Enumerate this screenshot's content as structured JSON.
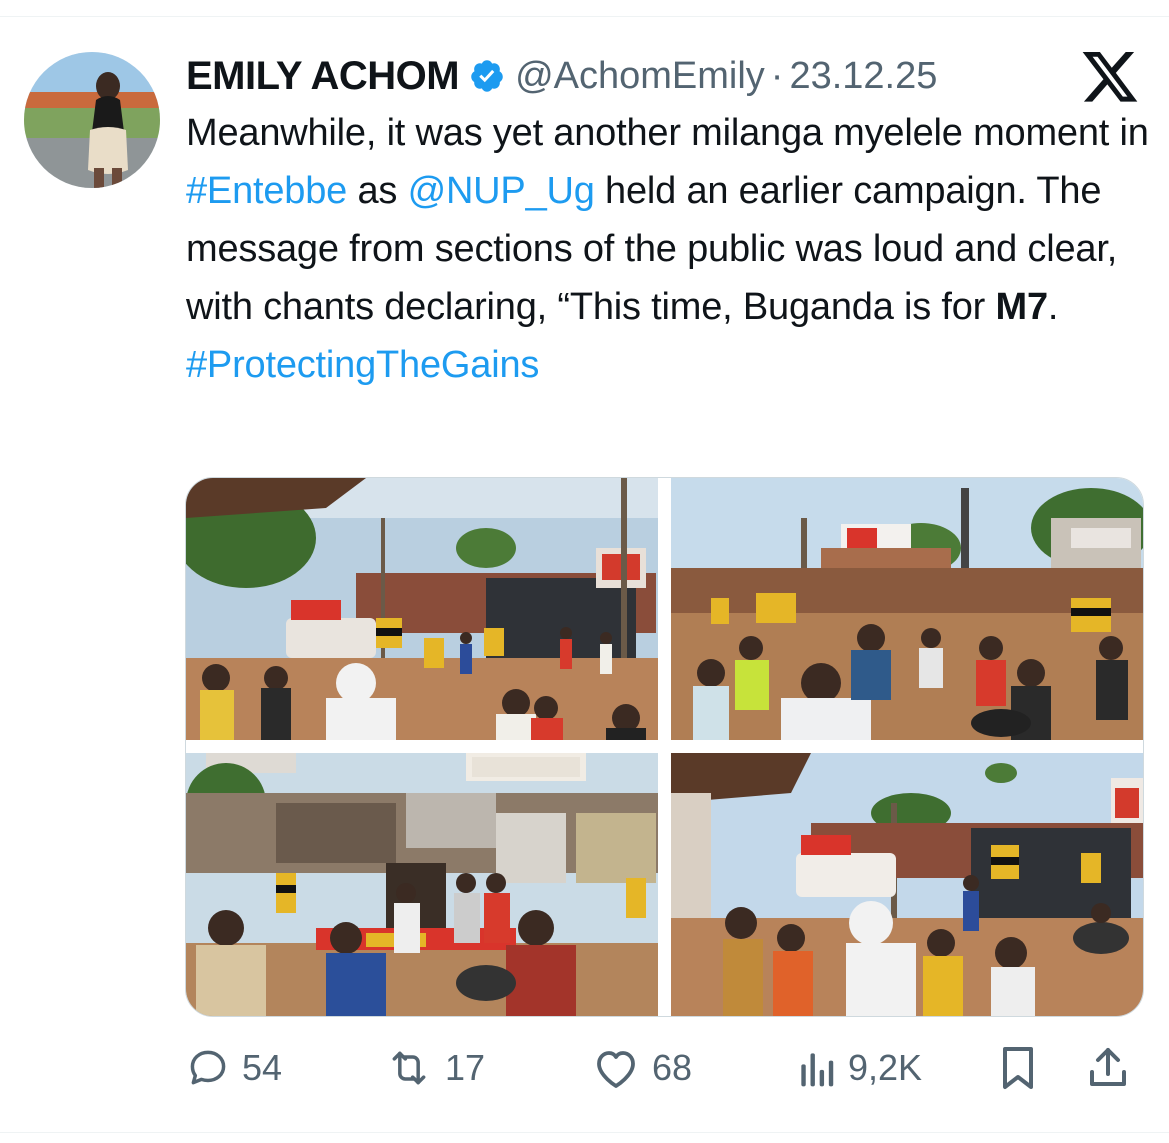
{
  "tweet": {
    "display_name": "EMILY ACHOM",
    "handle": "@AchomEmily",
    "separator": "·",
    "date": "23.12.25",
    "text": {
      "t1": "Meanwhile, it was yet another milanga myelele moment in ",
      "hashtag_entebbe": "#Entebbe",
      "t2": " as ",
      "mention_nup": "@NUP_Ug",
      "t3": " held an earlier campaign. The message from sections of the public was loud and clear, with chants declaring, “This time, Buganda is for ",
      "bold_m7": "M7",
      "t4": ".",
      "hashtag_gains": "#ProtectingTheGains"
    }
  },
  "actions": {
    "replies": "54",
    "reposts": "17",
    "likes": "68",
    "views": "9,2K"
  },
  "icons": {
    "verified": "verified-badge-icon",
    "platform": "x-logo-icon",
    "reply": "reply-icon",
    "repost": "repost-icon",
    "like": "heart-icon",
    "views": "views-icon",
    "bookmark": "bookmark-icon",
    "share": "share-icon"
  },
  "colors": {
    "link": "#1d9bf0",
    "secondary_text": "#536471",
    "primary_text": "#0f1419"
  }
}
